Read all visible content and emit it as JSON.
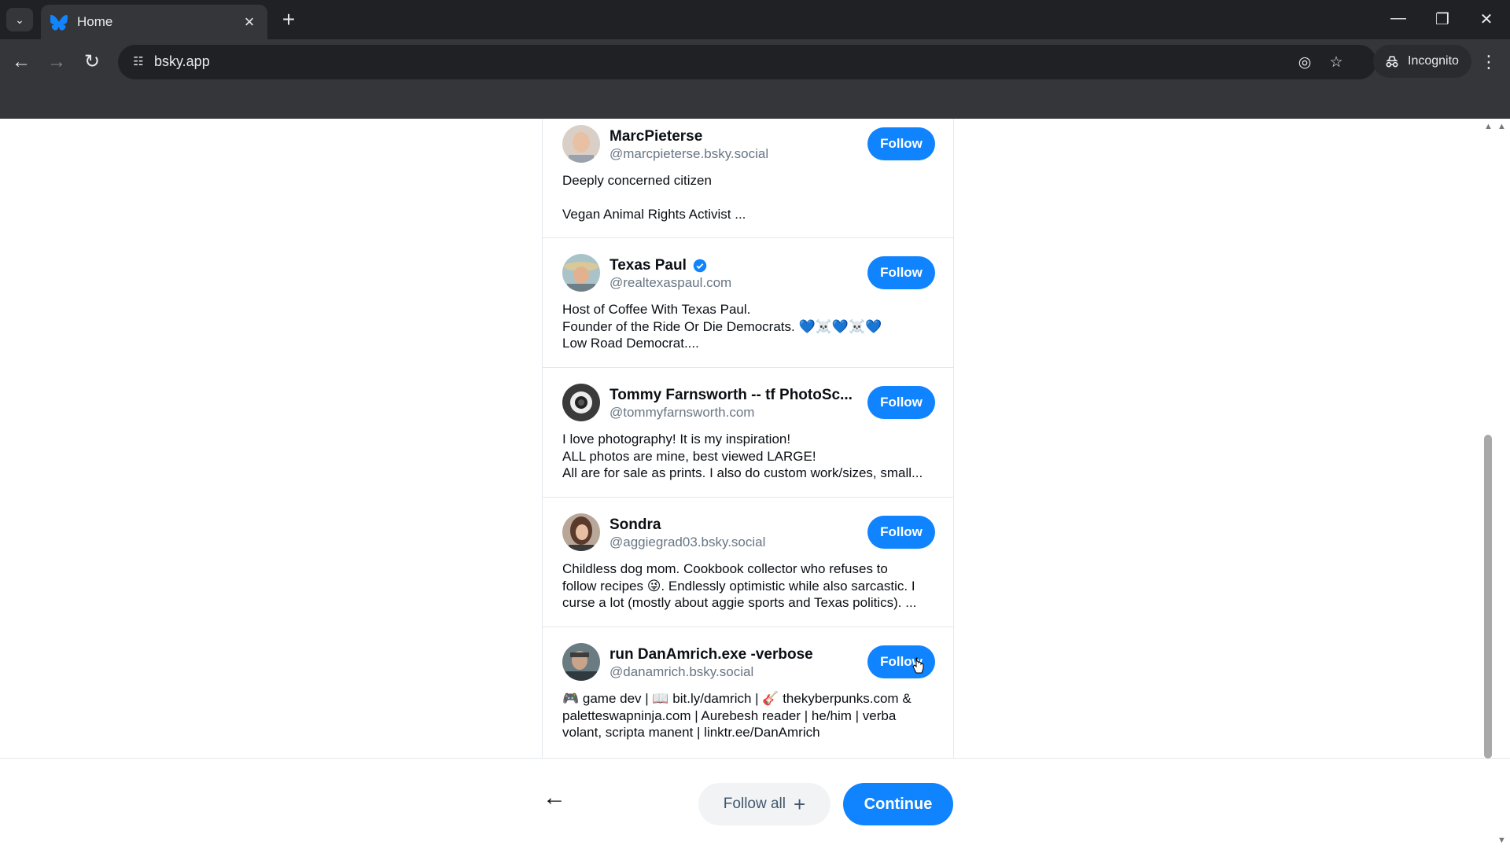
{
  "browser": {
    "tab_title": "Home",
    "url": "bsky.app",
    "incognito_label": "Incognito",
    "icons": [
      "tab-list-icon",
      "bluesky-butterfly-icon",
      "close-icon",
      "new-tab-icon",
      "minimize-icon",
      "restore-icon",
      "window-close-icon",
      "back-icon",
      "forward-icon",
      "reload-icon",
      "site-info-icon",
      "eye-off-icon",
      "star-icon",
      "incognito-icon",
      "more-icon"
    ]
  },
  "suggested": [
    {
      "name": "MarcPieterse",
      "handle": "@marcpieterse.bsky.social",
      "follow_label": "Follow",
      "bio": "Deeply concerned citizen\n\nVegan Animal Rights Activist ...",
      "verified": false
    },
    {
      "name": "Texas Paul",
      "handle": "@realtexaspaul.com",
      "follow_label": "Follow",
      "bio": "Host of Coffee With Texas Paul.\nFounder of the Ride Or Die Democrats.  💙☠️💙☠️💙\nLow Road Democrat....",
      "verified": true
    },
    {
      "name": "Tommy Farnsworth -- tf PhotoSc...",
      "handle": "@tommyfarnsworth.com",
      "follow_label": "Follow",
      "bio": "I love photography! It is my inspiration!\nALL photos are mine, best viewed LARGE!\nAll are for sale as prints. I also do custom work/sizes, small...",
      "verified": false
    },
    {
      "name": "Sondra",
      "handle": "@aggiegrad03.bsky.social",
      "follow_label": "Follow",
      "bio": "Childless dog mom. Cookbook collector who refuses to\nfollow recipes 😜. Endlessly optimistic while also sarcastic. I\ncurse a lot (mostly about aggie sports and Texas politics). ...",
      "verified": false
    },
    {
      "name": "run DanAmrich.exe -verbose",
      "handle": "@danamrich.bsky.social",
      "follow_label": "Follow",
      "bio": "🎮 game dev | 📖 bit.ly/damrich | 🎸 thekyberpunks.com &\npaletteswapninja.com | Aurebesh reader | he/him | verba\nvolant, scripta manent | linktr.ee/DanAmrich",
      "verified": false
    }
  ],
  "footer": {
    "back_icon": "arrow-left-icon",
    "follow_all_label": "Follow all",
    "follow_all_icon": "plus-icon",
    "continue_label": "Continue"
  },
  "colors": {
    "accent": "#1083fe",
    "text": "#0b0f14",
    "muted": "#687684",
    "chrome_dark": "#202124",
    "chrome": "#35363a"
  }
}
